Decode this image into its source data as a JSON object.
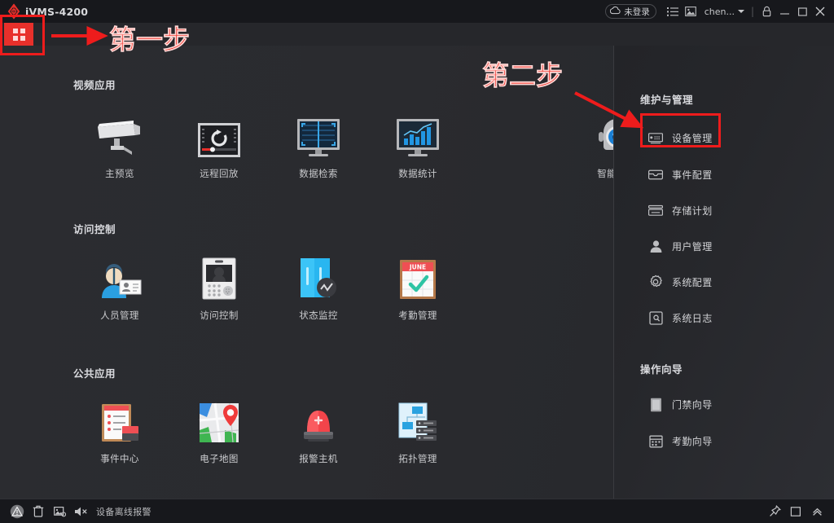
{
  "window": {
    "title": "iVMS-4200",
    "logo_icon": "hikvision-diamond-logo-icon",
    "home_button_icon": "grid-menu-icon"
  },
  "titlebar": {
    "cloud_status": "未登录",
    "cloud_icon": "cloud-icon",
    "list_icon": "list-icon",
    "picture_icon": "picture-icon",
    "user_name": "chen...",
    "caret_icon": "chevron-down-icon",
    "separator": "|",
    "lock_icon": "lock-icon",
    "minimize_icon": "minimize-icon",
    "maximize_icon": "maximize-icon",
    "close_icon": "close-icon"
  },
  "sections": [
    {
      "title": "视频应用",
      "items": [
        {
          "label": "主预览",
          "icon": "camera-icon"
        },
        {
          "label": "远程回放",
          "icon": "playback-monitor-icon"
        },
        {
          "label": "数据检索",
          "icon": "search-monitor-icon"
        },
        {
          "label": "数据统计",
          "icon": "chart-monitor-icon"
        },
        {
          "label": "智能应用",
          "icon": "robot-icon"
        }
      ]
    },
    {
      "title": "访问控制",
      "items": [
        {
          "label": "人员管理",
          "icon": "person-card-icon"
        },
        {
          "label": "访问控制",
          "icon": "access-terminal-icon"
        },
        {
          "label": "状态监控",
          "icon": "door-monitor-icon"
        },
        {
          "label": "考勤管理",
          "icon": "calendar-check-icon"
        }
      ]
    },
    {
      "title": "公共应用",
      "items": [
        {
          "label": "事件中心",
          "icon": "event-clipboard-icon"
        },
        {
          "label": "电子地图",
          "icon": "map-pin-icon"
        },
        {
          "label": "报警主机",
          "icon": "alarm-siren-icon"
        },
        {
          "label": "拓扑管理",
          "icon": "topology-icon"
        }
      ]
    }
  ],
  "right_panel": {
    "maintenance": {
      "title": "维护与管理",
      "items": [
        {
          "label": "设备管理",
          "icon": "device-box-icon",
          "highlighted": true
        },
        {
          "label": "事件配置",
          "icon": "event-config-icon",
          "highlighted": false
        },
        {
          "label": "存储计划",
          "icon": "storage-icon",
          "highlighted": false
        },
        {
          "label": "用户管理",
          "icon": "user-icon",
          "highlighted": false
        },
        {
          "label": "系统配置",
          "icon": "gear-icon",
          "highlighted": false
        },
        {
          "label": "系统日志",
          "icon": "log-icon",
          "highlighted": false
        }
      ]
    },
    "wizard": {
      "title": "操作向导",
      "items": [
        {
          "label": "门禁向导",
          "icon": "door-wizard-icon"
        },
        {
          "label": "考勤向导",
          "icon": "attendance-wizard-icon"
        }
      ]
    }
  },
  "statusbar": {
    "alarm_icon": "warning-triangle-icon",
    "trash_icon": "trash-icon",
    "picture_icon": "picture-icon",
    "mute_icon": "speaker-mute-icon",
    "message": "设备离线报警",
    "pin_icon": "pin-icon",
    "panel_icon": "panel-icon",
    "chevron_up_icon": "chevron-up-icon"
  },
  "annotations": {
    "step_one": "第一步",
    "step_two": "第二步",
    "accent_color": "#ee1c1c"
  }
}
